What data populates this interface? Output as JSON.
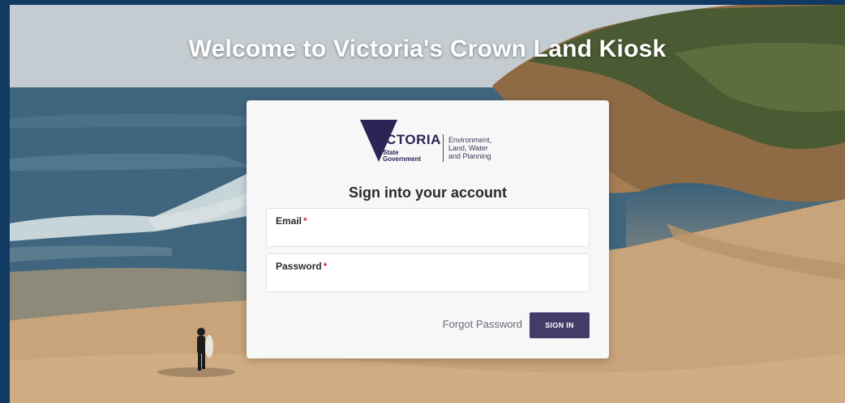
{
  "hero": {
    "title": "Welcome to Victoria's Crown Land Kiosk"
  },
  "logo": {
    "wordmark": "VICTORIA",
    "sub_line1": "State",
    "sub_line2": "Government",
    "dept_line1": "Environment,",
    "dept_line2": "Land, Water",
    "dept_line3": "and Planning"
  },
  "login": {
    "heading": "Sign into your account",
    "email_label": "Email",
    "email_value": "",
    "password_label": "Password",
    "password_value": "",
    "required_marker": "*",
    "forgot_label": "Forgot Password",
    "signin_label": "SIGN IN"
  },
  "colors": {
    "page_frame": "#113a63",
    "brand_navy": "#413c6a",
    "required": "#d42a3a",
    "card_bg": "#f7f7f8"
  },
  "icons": {
    "logo_mark": "victoria-triangle-logo"
  }
}
